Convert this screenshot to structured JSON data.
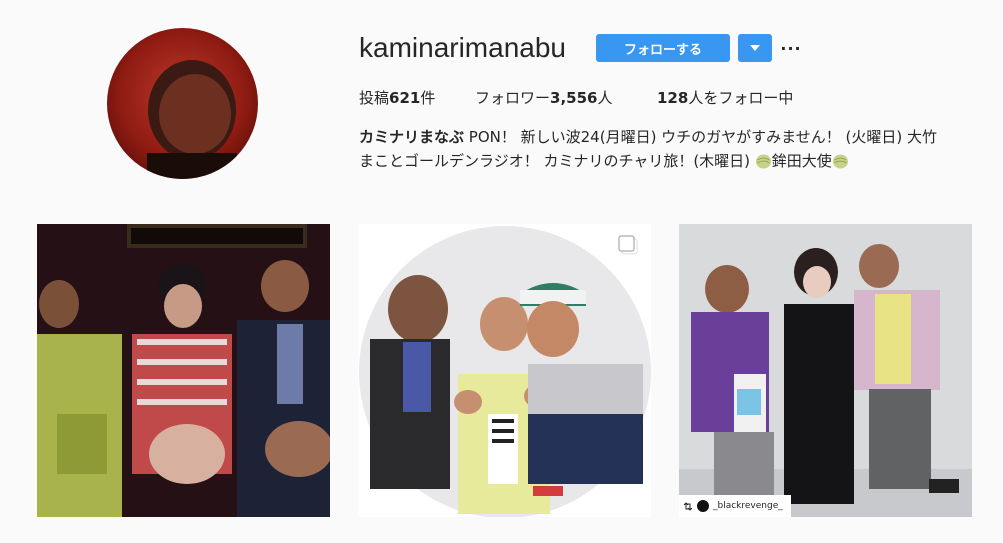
{
  "profile": {
    "username": "kaminarimanabu",
    "follow_label": "フォローする",
    "more_label": "···"
  },
  "stats": {
    "posts_label": "投稿",
    "posts_value": "621",
    "posts_unit": "件",
    "followers_label": "フォロワー",
    "followers_value": "3,556",
    "followers_unit": "人",
    "following_value": "128",
    "following_label": "人をフォロー中"
  },
  "bio": {
    "name": "カミナリまなぶ",
    "line1": " PON！ 新しい波24(月曜日) ウチのガヤがすみません！ (火曜日) 大竹",
    "line2": "まことゴールデンラジオ！ カミナリのチャリ旅！(木曜日) ",
    "line2_end": "鉾田大使"
  },
  "posts": [
    {
      "kind": "photo"
    },
    {
      "kind": "carousel"
    },
    {
      "kind": "photo",
      "repost_user": "_blackrevenge_"
    }
  ],
  "colors": {
    "accent": "#3897f0",
    "background": "#fafafa",
    "text": "#262626"
  },
  "icons": [
    "chevron-down-icon",
    "more-icon",
    "melon-icon",
    "carousel-icon",
    "repost-icon"
  ]
}
